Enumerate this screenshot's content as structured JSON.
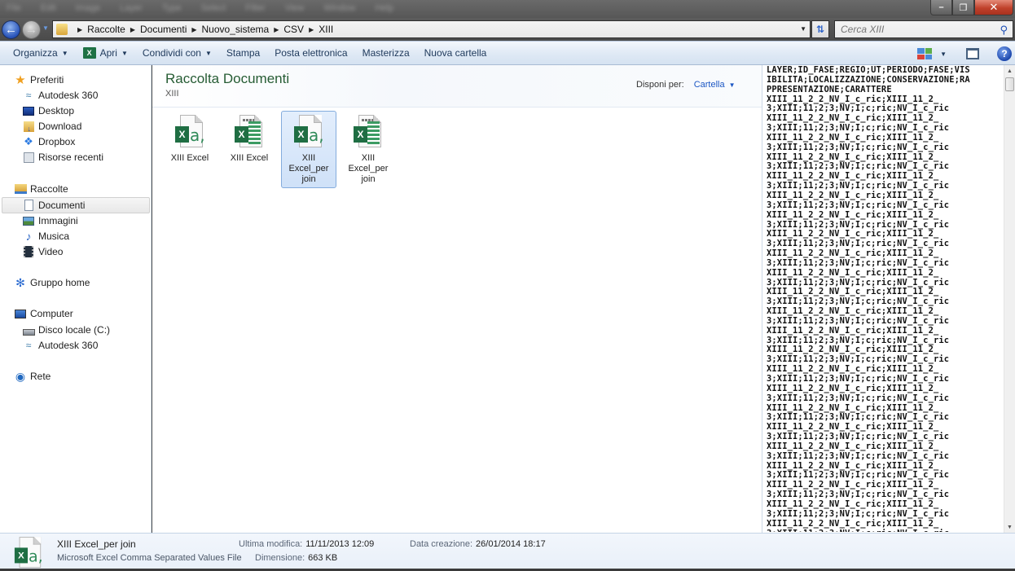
{
  "window": {
    "blurred_menu": [
      "File",
      "Edit",
      "Image",
      "Layer",
      "Type",
      "Select",
      "Filter",
      "View",
      "Window",
      "Help"
    ],
    "minimize_glyph": "–",
    "restore_glyph": "❐",
    "close_glyph": "✕"
  },
  "nav": {
    "back_icon": "arrow-left",
    "forward_icon": "arrow-right",
    "breadcrumb": [
      "Raccolte",
      "Documenti",
      "Nuovo_sistema",
      "CSV",
      "XIII"
    ],
    "search_placeholder": "Cerca XIII"
  },
  "commands": {
    "organize": "Organizza",
    "open": "Apri",
    "share": "Condividi con",
    "print": "Stampa",
    "email": "Posta elettronica",
    "burn": "Masterizza",
    "new_folder": "Nuova cartella",
    "help_glyph": "?"
  },
  "sidebar": {
    "favorites": {
      "label": "Preferiti",
      "items": [
        {
          "label": "Autodesk 360",
          "icon": "cloud-icon"
        },
        {
          "label": "Desktop",
          "icon": "desktop-icon"
        },
        {
          "label": "Download",
          "icon": "download-folder-icon"
        },
        {
          "label": "Dropbox",
          "icon": "dropbox-icon"
        },
        {
          "label": "Risorse recenti",
          "icon": "recent-places-icon"
        }
      ]
    },
    "libraries": {
      "label": "Raccolte",
      "items": [
        {
          "label": "Documenti",
          "icon": "documents-icon",
          "selected": true
        },
        {
          "label": "Immagini",
          "icon": "pictures-icon"
        },
        {
          "label": "Musica",
          "icon": "music-icon"
        },
        {
          "label": "Video",
          "icon": "video-icon"
        }
      ]
    },
    "homegroup": {
      "label": "Gruppo home"
    },
    "computer": {
      "label": "Computer",
      "items": [
        {
          "label": "Disco locale (C:)",
          "icon": "drive-icon"
        },
        {
          "label": "Autodesk 360",
          "icon": "cloud-icon"
        }
      ]
    },
    "network": {
      "label": "Rete"
    }
  },
  "library": {
    "title": "Raccolta Documenti",
    "subtitle": "XIII",
    "arrange_label": "Disponi per:",
    "arrange_value": "Cartella"
  },
  "files": [
    {
      "name": "XIII Excel",
      "type": "csv",
      "selected": false
    },
    {
      "name": "XIII Excel",
      "type": "xlsx",
      "selected": false
    },
    {
      "name": "XIII Excel_per join",
      "type": "csv",
      "selected": true
    },
    {
      "name": "XIII Excel_per join",
      "type": "xlsx",
      "selected": false
    }
  ],
  "preview": {
    "header_lines": [
      "LAYER;ID_FASE;REGIO;UT;PERIODO;FASE;VIS",
      "IBILITA;LOCALIZZAZIONE;CONSERVAZIONE;RA",
      "PPRESENTAZIONE;CARATTERE"
    ],
    "row_line_a": "XIII_11_2_2_NV_I_c_ric;XIII_11_2_",
    "row_line_b": "3;XIII;11;2;3;NV;I;c;ric;NV_I_c_ric",
    "row_repeat": 24
  },
  "details": {
    "name": "XIII Excel_per join",
    "type": "Microsoft Excel Comma Separated Values File",
    "modified_label": "Ultima modifica:",
    "modified_value": "11/11/2013 12:09",
    "size_label": "Dimensione:",
    "size_value": "663 KB",
    "created_label": "Data creazione:",
    "created_value": "26/01/2014 18:17"
  }
}
